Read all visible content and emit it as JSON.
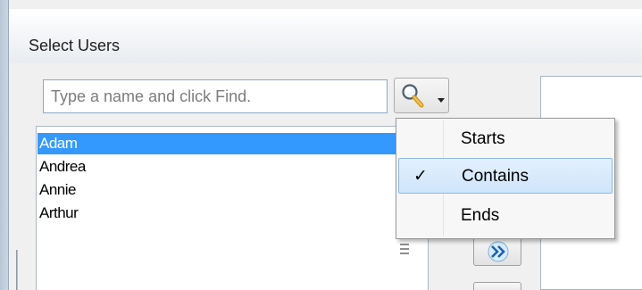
{
  "window": {
    "title": "Select Users"
  },
  "search": {
    "placeholder": "Type a name and click Find.",
    "value": ""
  },
  "find_button": {
    "icon": "search-icon"
  },
  "users": [
    {
      "name": "Adam",
      "selected": true
    },
    {
      "name": "Andrea",
      "selected": false
    },
    {
      "name": "Annie",
      "selected": false
    },
    {
      "name": "Arthur",
      "selected": false
    }
  ],
  "match_menu": {
    "items": [
      {
        "label": "Starts",
        "checked": false
      },
      {
        "label": "Contains",
        "checked": true
      },
      {
        "label": "Ends",
        "checked": false
      }
    ],
    "check_glyph": "✓"
  },
  "buttons": {
    "add_icon": "double-chevron-right-icon"
  },
  "colors": {
    "selection": "#3399ff",
    "menu_highlight": "#cfe5fb"
  }
}
